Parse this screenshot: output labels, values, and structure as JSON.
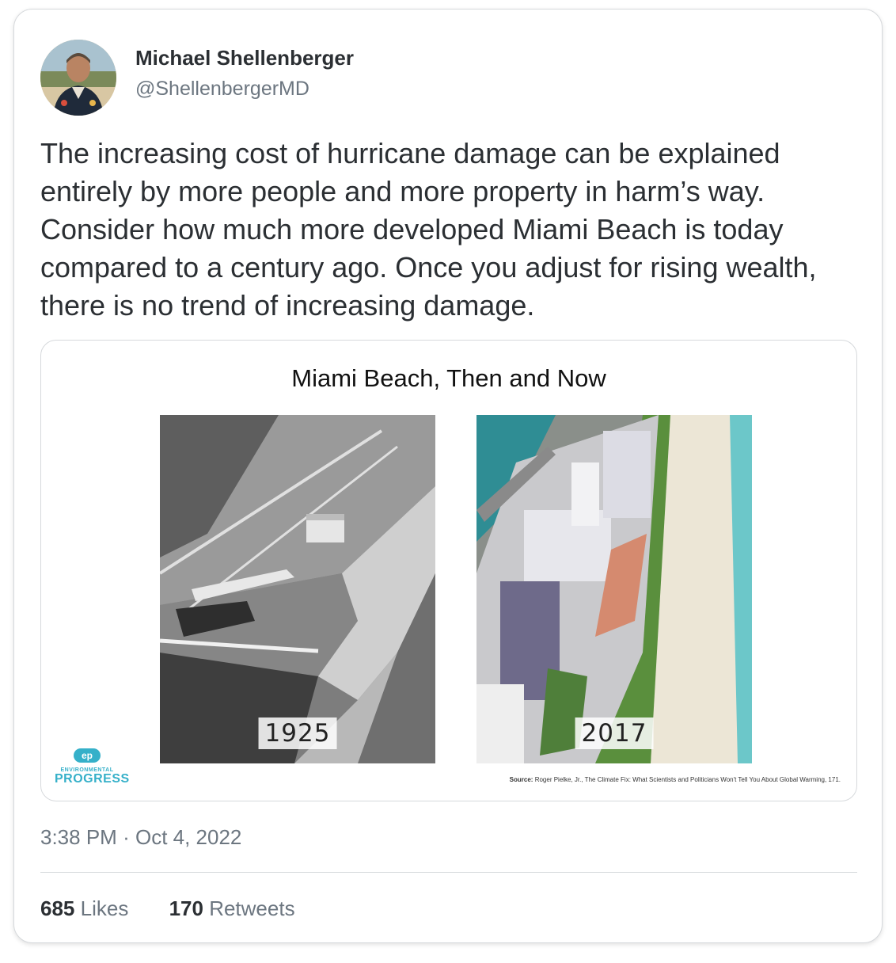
{
  "author": {
    "name": "Michael Shellenberger",
    "handle": "@ShellenbergerMD"
  },
  "tweet": {
    "text": "The increasing cost of hurricane damage can be explained entirely by more people and more property in harm’s way. Consider how much more developed Miami Beach is today compared to a century ago. Once you adjust for rising wealth, there is no trend of increasing damage."
  },
  "media": {
    "title": "Miami Beach, Then and Now",
    "left_year": "1925",
    "right_year": "2017",
    "logo_mark": "ep",
    "logo_small": "ENVIRONMENTAL",
    "logo_big": "PROGRESS",
    "source_label": "Source:",
    "source_text": "Roger Pielke, Jr., The Climate Fix: What Scientists and Politicians Won't Tell You About Global Warming, 171."
  },
  "meta": {
    "time": "3:38 PM",
    "separator": "·",
    "date": "Oct 4, 2022"
  },
  "stats": {
    "likes_count": "685",
    "likes_label": "Likes",
    "retweets_count": "170",
    "retweets_label": "Retweets"
  },
  "colors": {
    "text_primary": "#2b2f33",
    "text_secondary": "#6c7680",
    "border": "#d6d9dc",
    "logo_accent": "#35b0c9"
  }
}
